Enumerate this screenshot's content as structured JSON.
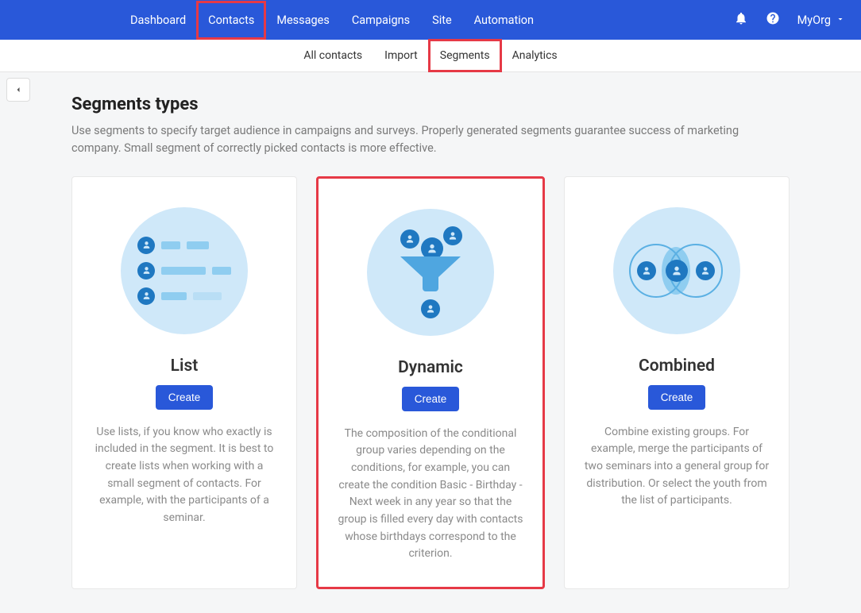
{
  "topnav": {
    "items": [
      {
        "label": "Dashboard"
      },
      {
        "label": "Contacts",
        "highlighted": true
      },
      {
        "label": "Messages"
      },
      {
        "label": "Campaigns"
      },
      {
        "label": "Site"
      },
      {
        "label": "Automation"
      }
    ],
    "org": "MyOrg"
  },
  "subnav": {
    "items": [
      {
        "label": "All contacts"
      },
      {
        "label": "Import"
      },
      {
        "label": "Segments",
        "highlighted": true
      },
      {
        "label": "Analytics"
      }
    ]
  },
  "page": {
    "title": "Segments types",
    "description": "Use segments to specify target audience in campaigns and surveys. Properly generated segments guarantee success of marketing company. Small segment of correctly picked contacts is more effective."
  },
  "cards": [
    {
      "title": "List",
      "create_label": "Create",
      "description": "Use lists, if you know who exactly is included in the segment. It is best to create lists when working with a small segment of contacts. For example, with the participants of a seminar.",
      "highlighted": false
    },
    {
      "title": "Dynamic",
      "create_label": "Create",
      "description": "The composition of the conditional group varies depending on the conditions, for example, you can create the condition Basic - Birthday - Next week in any year so that the group is filled every day with contacts whose birthdays correspond to the criterion.",
      "highlighted": true
    },
    {
      "title": "Combined",
      "create_label": "Create",
      "description": "Combine existing groups. For example, merge the participants of two seminars into a general group for distribution. Or select the youth from the list of participants.",
      "highlighted": false
    }
  ]
}
